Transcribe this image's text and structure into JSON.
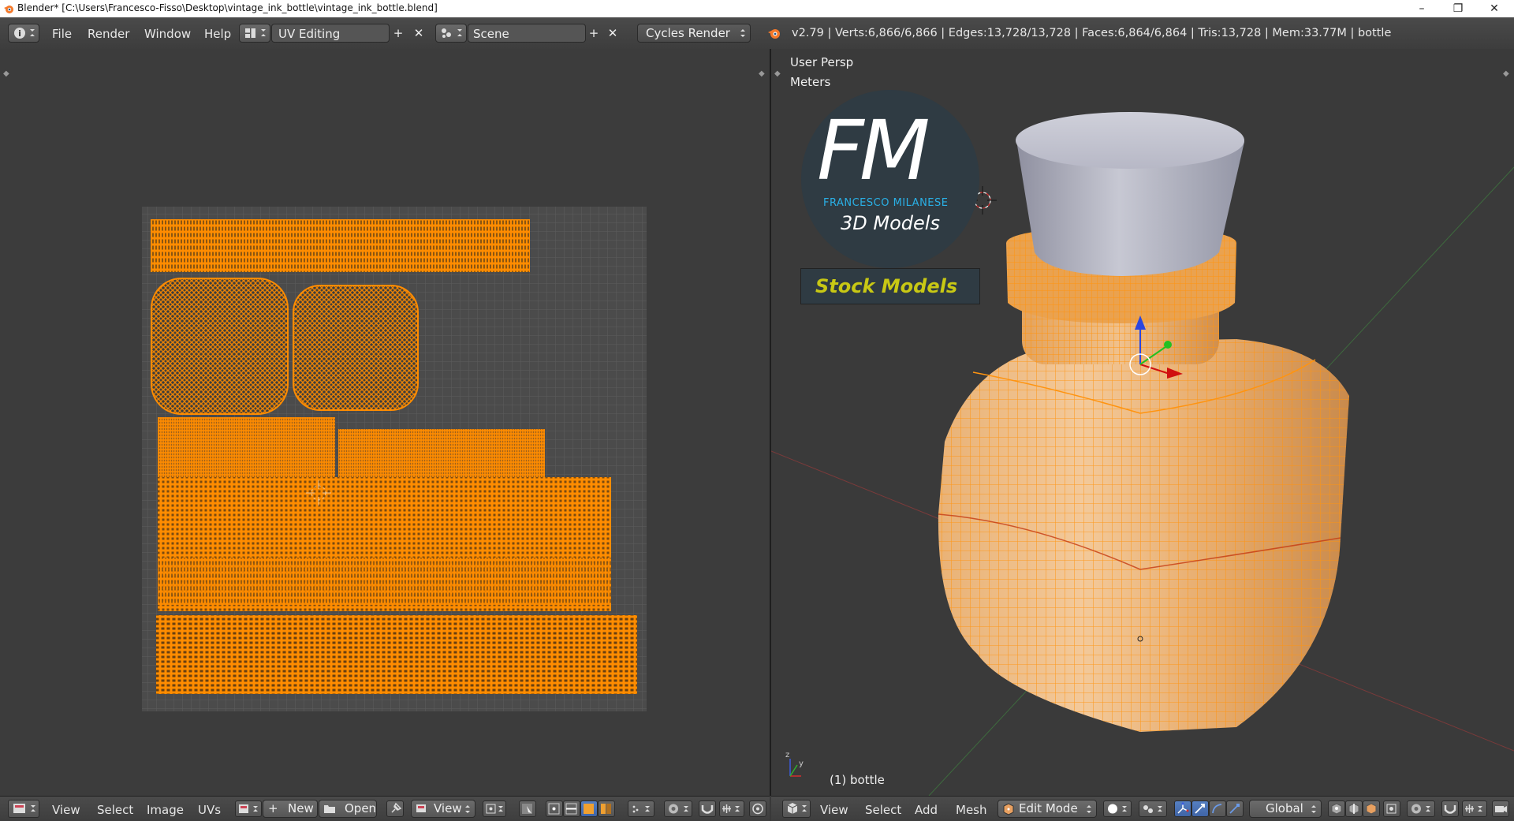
{
  "window": {
    "title": "Blender* [C:\\Users\\Francesco-Fisso\\Desktop\\vintage_ink_bottle\\vintage_ink_bottle.blend]",
    "minimize": "–",
    "restore": "❐",
    "close": "✕"
  },
  "info_header": {
    "menu": [
      "File",
      "Render",
      "Window",
      "Help"
    ],
    "screen_layout": "UV Editing",
    "scene": "Scene",
    "render_engine": "Cycles Render",
    "stats": "v2.79 | Verts:6,866/6,866 | Edges:13,728/13,728 | Faces:6,864/6,864 | Tris:13,728 | Mem:33.77M | bottle"
  },
  "uv_editor": {
    "header": {
      "menu": [
        "View",
        "Select",
        "Image",
        "UVs"
      ],
      "new_button": "New",
      "open_button": "Open",
      "view_dropdown": "View"
    },
    "grid_color": "#4b4b4b",
    "uv_color": "#ff8c00"
  },
  "viewport": {
    "overlay_view": "User Persp",
    "overlay_units": "Meters",
    "object_label": "(1) bottle",
    "header": {
      "menu": [
        "View",
        "Select",
        "Add",
        "Mesh"
      ],
      "mode": "Edit Mode",
      "orientation": "Global"
    },
    "logo": {
      "monogram": "FM",
      "brand": "FRANCESCO MILANESE",
      "tagline": "3D Models",
      "banner": "Stock Models",
      "accent": "#2ab0e6",
      "banner_color": "#c8c814"
    },
    "mesh_color": "#ff9a1e",
    "cap_color": "#a9aab8"
  }
}
